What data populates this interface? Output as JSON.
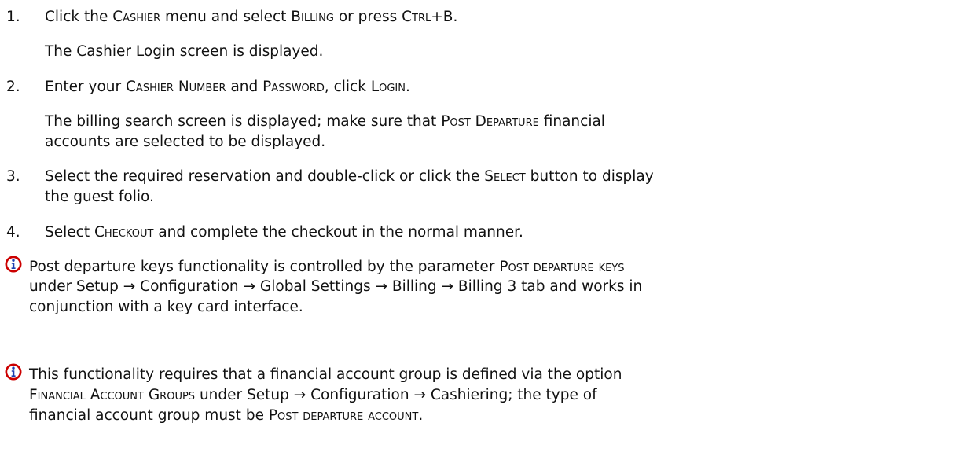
{
  "colors": {
    "text": "#111111",
    "icon_red": "#cc0000",
    "icon_blue": "#1c3fb0"
  },
  "steps": [
    {
      "number": "1.",
      "text": {
        "a": "Click the ",
        "b": "Cashier",
        "c": " menu and select ",
        "d": "Billing",
        "e": " or press ",
        "f": "Ctrl+B",
        "g": "."
      },
      "result": "The Cashier Login screen is displayed."
    },
    {
      "number": "2.",
      "text": {
        "a": "Enter your ",
        "b": "Cashier Number",
        "c": " and ",
        "d": "Password",
        "e": ", click ",
        "f": "Login",
        "g": "."
      },
      "result": {
        "line1a": "The billing search screen is displayed; make sure that ",
        "line1b": "Post Departure",
        "line1c": " financial",
        "line2": "accounts are selected to be displayed."
      }
    },
    {
      "number": "3.",
      "text": {
        "line1a": "Select the required reservation and double-click or click the ",
        "line1b": "Select",
        "line1c": " button to display",
        "line2": "the guest folio."
      }
    },
    {
      "number": "4.",
      "text": {
        "a": "Select ",
        "b": "Checkout",
        "c": " and complete the checkout in the normal manner."
      }
    }
  ],
  "notes": [
    {
      "icon": "info-icon",
      "line1a": "Post departure keys functionality is controlled by the parameter ",
      "line1b": "Post departure keys",
      "line2": "under Setup → Configuration → Global Settings → Billing → Billing 3 tab and works in",
      "line3": "conjunction with a key card interface."
    },
    {
      "icon": "info-icon",
      "line1": "This functionality requires that a financial account group is defined via the option",
      "line2a": "Financial Account Groups",
      "line2b": " under Setup → Configuration → Cashiering; the type of",
      "line3a": "financial account group must be ",
      "line3b": "Post departure account",
      "line3c": "."
    }
  ]
}
